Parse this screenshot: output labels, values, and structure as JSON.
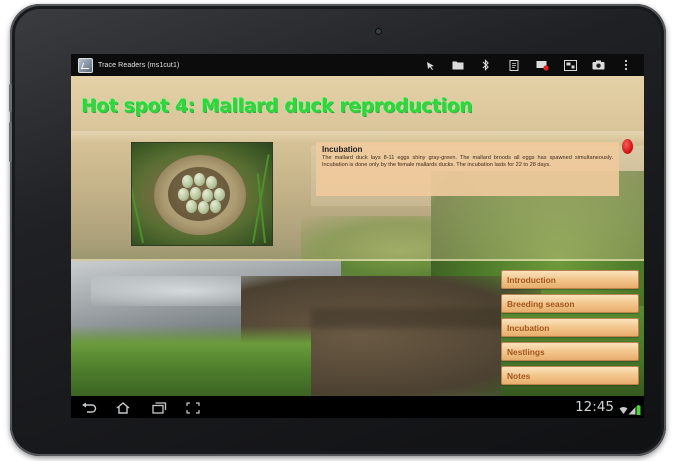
{
  "app": {
    "title": "Trace Readers (ms1cut1)"
  },
  "action_bar": {
    "icons": [
      "pointer-icon",
      "folder-icon",
      "bluetooth-scan-icon",
      "clipboard-icon",
      "record-icon",
      "layout-icon",
      "camera-icon",
      "overflow-menu-icon"
    ]
  },
  "page": {
    "title": "Hot spot 4: Mallard duck reproduction"
  },
  "popup": {
    "heading": "Incubation",
    "text": "The mallard duck lays 8-11 eggs shiny gray-green. The mallard broods all eggs has spawned simultaneously. Incubation is done only by the female mallards ducks. The incubation lasts for 22 to 28 days."
  },
  "menu": {
    "items": [
      "Introduction",
      "Breeding season",
      "Incubation",
      "Nestlings",
      "Notes"
    ]
  },
  "system_bar": {
    "clock": "12:45",
    "nav_icons": [
      "back-icon",
      "home-icon",
      "recent-apps-icon",
      "screenshot-icon"
    ],
    "status_icons": [
      "wifi-icon",
      "signal-icon",
      "battery-icon"
    ]
  },
  "colors": {
    "title_green": "#2fd63a",
    "menu_text": "#a3561c",
    "menu_bg": "#f1c48a",
    "popup_bg": "#f0ca9c",
    "hotspot_marker": "#d41616"
  }
}
